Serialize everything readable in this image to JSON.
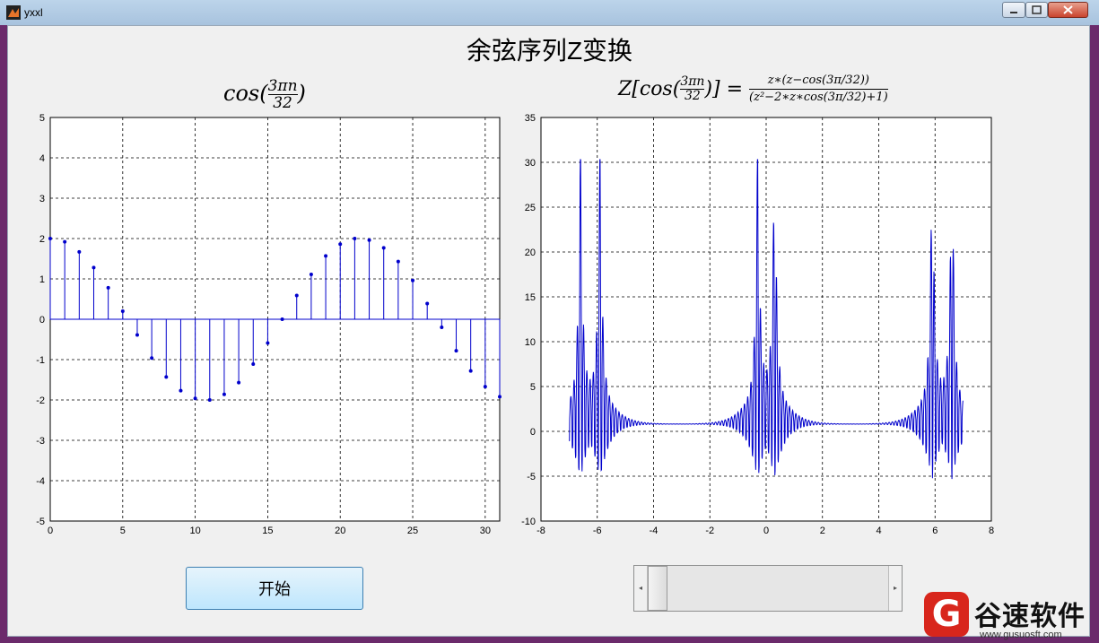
{
  "window": {
    "title": "yxxl"
  },
  "figure": {
    "title_cn": "余弦序列",
    "title_z": "Z",
    "title_cn2": "变换",
    "left_title": "cos(3πn/32)",
    "right_title_lhs": "Z[cos(3πn/32)] =",
    "right_title_num": "z∗(z−cos(3π/32))",
    "right_title_den": "(z²−2∗z∗cos(3π/32)+1)"
  },
  "controls": {
    "start_label": "开始",
    "slider_left_arrow": "◂",
    "slider_right_arrow": "▸"
  },
  "watermark": {
    "logo": "G",
    "name": "谷速软件",
    "url": "www.gusuosft.com"
  },
  "colors": {
    "series": "#0000cc",
    "grid": "#000000",
    "client_bg": "#f0f0f0"
  },
  "chart_data": [
    {
      "type": "stem",
      "title": "cos(3πn/32)",
      "xlim": [
        0,
        31
      ],
      "ylim": [
        -5,
        5
      ],
      "xticks": [
        0,
        5,
        10,
        15,
        20,
        25,
        30
      ],
      "yticks": [
        -5,
        -4,
        -3,
        -2,
        -1,
        0,
        1,
        2,
        3,
        4,
        5
      ],
      "grid": true,
      "n": [
        0,
        1,
        2,
        3,
        4,
        5,
        6,
        7,
        8,
        9,
        10,
        11,
        12,
        13,
        14,
        15,
        16,
        17,
        18,
        19,
        20,
        21,
        22,
        23,
        24,
        25,
        26,
        27,
        28,
        29,
        30,
        31
      ],
      "values": [
        2.0,
        1.92,
        1.67,
        1.28,
        0.78,
        0.2,
        -0.39,
        -0.96,
        -1.43,
        -1.77,
        -1.96,
        -2.0,
        -1.86,
        -1.57,
        -1.11,
        -0.59,
        0.0,
        0.59,
        1.11,
        1.57,
        1.86,
        2.0,
        1.96,
        1.77,
        1.43,
        0.96,
        0.39,
        -0.2,
        -0.78,
        -1.28,
        -1.67,
        -1.92
      ]
    },
    {
      "type": "line",
      "title": "Z[cos(3πn/32)]",
      "xlim": [
        -8,
        8
      ],
      "ylim": [
        -10,
        35
      ],
      "xticks": [
        -8,
        -6,
        -4,
        -2,
        0,
        2,
        4,
        6,
        8
      ],
      "yticks": [
        -10,
        -5,
        0,
        5,
        10,
        15,
        20,
        25,
        30,
        35
      ],
      "grid": true,
      "x_range": [
        -7,
        7
      ],
      "peaks_x": [
        -6.6,
        -5.9,
        -0.3,
        0.3,
        5.9,
        6.6
      ],
      "peak_y": 30,
      "baseline_y": 0.8
    }
  ]
}
